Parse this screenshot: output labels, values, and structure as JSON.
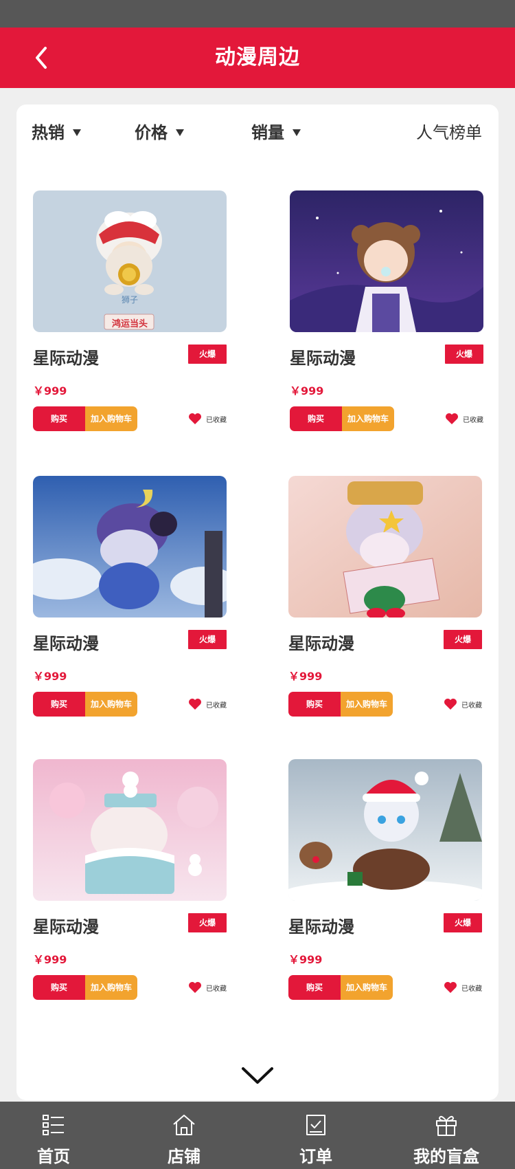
{
  "header": {
    "title": "动漫周边"
  },
  "filters": [
    {
      "label": "热销"
    },
    {
      "label": "价格"
    },
    {
      "label": "销量"
    },
    {
      "label": "人气榜单"
    }
  ],
  "products": [
    {
      "name": "星际动漫",
      "badge": "火爆",
      "price": "￥999",
      "buy_label": "购买",
      "cart_label": "加入购物车",
      "fav_label": "已收藏",
      "image_caption_top": "狮子",
      "image_caption_bottom": "鸿运当头"
    },
    {
      "name": "星际动漫",
      "badge": "火爆",
      "price": "￥999",
      "buy_label": "购买",
      "cart_label": "加入购物车",
      "fav_label": "已收藏"
    },
    {
      "name": "星际动漫",
      "badge": "火爆",
      "price": "￥999",
      "buy_label": "购买",
      "cart_label": "加入购物车",
      "fav_label": "已收藏"
    },
    {
      "name": "星际动漫",
      "badge": "火爆",
      "price": "￥999",
      "buy_label": "购买",
      "cart_label": "加入购物车",
      "fav_label": "已收藏"
    },
    {
      "name": "星际动漫",
      "badge": "火爆",
      "price": "￥999",
      "buy_label": "购买",
      "cart_label": "加入购物车",
      "fav_label": "已收藏"
    },
    {
      "name": "星际动漫",
      "badge": "火爆",
      "price": "￥999",
      "buy_label": "购买",
      "cart_label": "加入购物车",
      "fav_label": "已收藏"
    }
  ],
  "tabbar": [
    {
      "label": "首页",
      "icon": "list-icon"
    },
    {
      "label": "店铺",
      "icon": "home-icon"
    },
    {
      "label": "订单",
      "icon": "order-icon"
    },
    {
      "label": "我的盲盒",
      "icon": "gift-icon"
    }
  ],
  "colors": {
    "accent": "#e3183a",
    "cart": "#f2a32e",
    "bars": "#575757"
  }
}
